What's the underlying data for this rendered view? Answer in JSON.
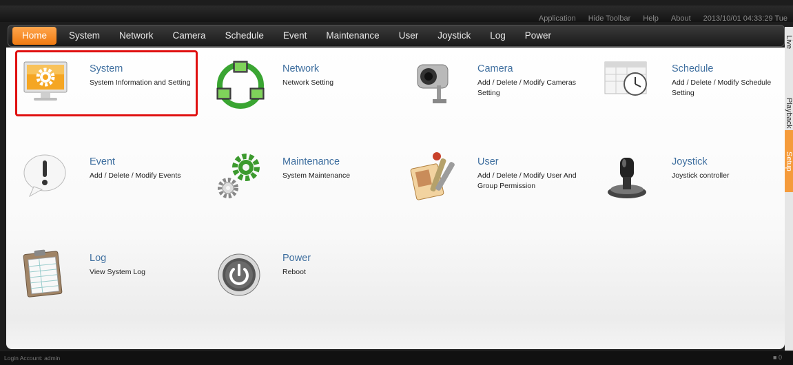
{
  "top_links": {
    "application": "Application",
    "hide_toolbar": "Hide Toolbar",
    "help": "Help",
    "about": "About",
    "datetime": "2013/10/01 04:33:29 Tue"
  },
  "nav": [
    "Home",
    "System",
    "Network",
    "Camera",
    "Schedule",
    "Event",
    "Maintenance",
    "User",
    "Joystick",
    "Log",
    "Power"
  ],
  "items": [
    {
      "title": "System",
      "desc": "System Information and Setting",
      "icon": "monitor-gear-icon"
    },
    {
      "title": "Network",
      "desc": "Network Setting",
      "icon": "network-computers-icon"
    },
    {
      "title": "Camera",
      "desc": "Add / Delete / Modify Cameras Setting",
      "icon": "security-camera-icon"
    },
    {
      "title": "Schedule",
      "desc": "Add / Delete / Modify Schedule Setting",
      "icon": "calendar-clock-icon"
    },
    {
      "title": "Event",
      "desc": "Add / Delete / Modify Events",
      "icon": "exclamation-bubble-icon"
    },
    {
      "title": "Maintenance",
      "desc": "System Maintenance",
      "icon": "gears-icon"
    },
    {
      "title": "User",
      "desc": "Add / Delete / Modify User And Group Permission",
      "icon": "user-badge-keys-icon"
    },
    {
      "title": "Joystick",
      "desc": "Joystick controller",
      "icon": "joystick-icon"
    },
    {
      "title": "Log",
      "desc": "View System Log",
      "icon": "clipboard-log-icon"
    },
    {
      "title": "Power",
      "desc": "Reboot",
      "icon": "power-button-icon"
    }
  ],
  "side_tabs": [
    "Live",
    "Playback",
    "Setup"
  ],
  "status": {
    "login": "Login Account: admin",
    "count": "0"
  },
  "colors": {
    "accent": "#f28b22",
    "link": "#3f6f9f",
    "highlight": "#e01010"
  }
}
